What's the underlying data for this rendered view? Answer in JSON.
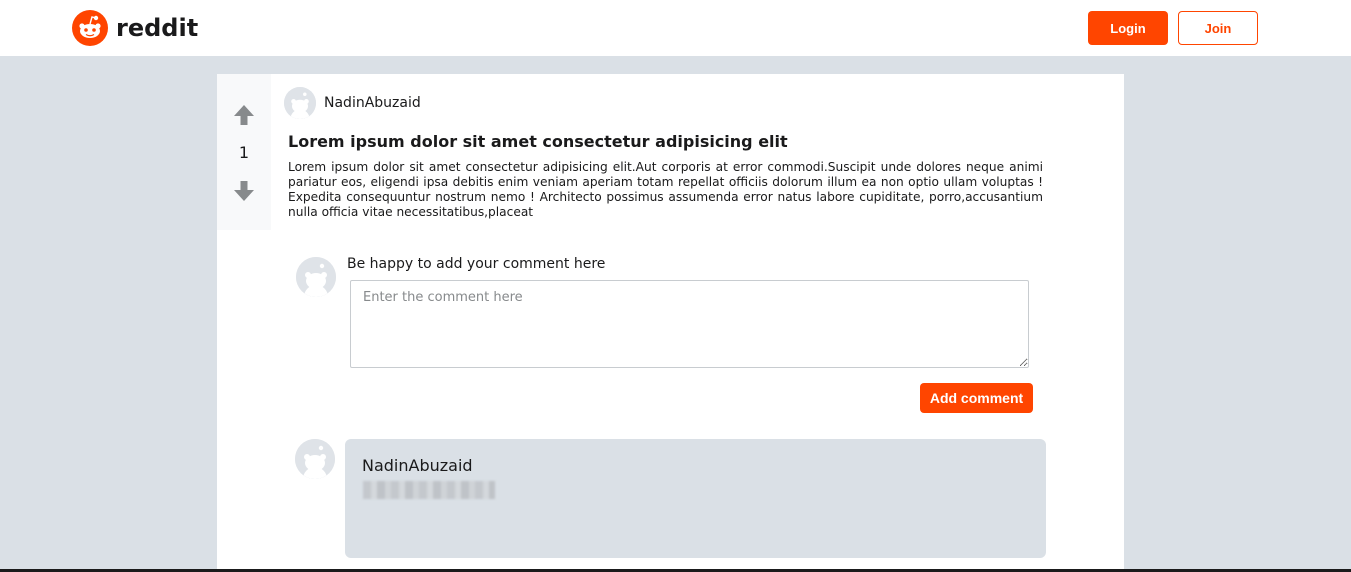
{
  "header": {
    "logo_text": "reddit",
    "login_label": "Login",
    "join_label": "Join",
    "accent_color": "#ff4500"
  },
  "post": {
    "vote_count": "1",
    "author": "NadinAbuzaid",
    "title": "Lorem ipsum dolor sit amet consectetur adipisicing elit",
    "body": "Lorem ipsum dolor sit amet consectetur adipisicing elit.Aut corporis at error commodi.Suscipit unde dolores neque animi pariatur eos, eligendi ipsa debitis enim veniam aperiam totam repellat officiis dolorum illum ea non optio ullam voluptas ! Expedita consequuntur nostrum nemo ! Architecto possimus assumenda error natus labore cupiditate, porro,accusantium nulla officia vitae necessitatibus,placeat"
  },
  "comment_form": {
    "prompt": "Be happy to add your comment here",
    "placeholder": "Enter the comment here",
    "value": "",
    "submit_label": "Add comment"
  },
  "comments": [
    {
      "author": "NadinAbuzaid",
      "text": "",
      "text_blurred": true
    }
  ],
  "icons": {
    "logo": "reddit-alien-icon",
    "upvote": "arrow-up-icon",
    "downvote": "arrow-down-icon",
    "avatar": "default-avatar-icon"
  }
}
